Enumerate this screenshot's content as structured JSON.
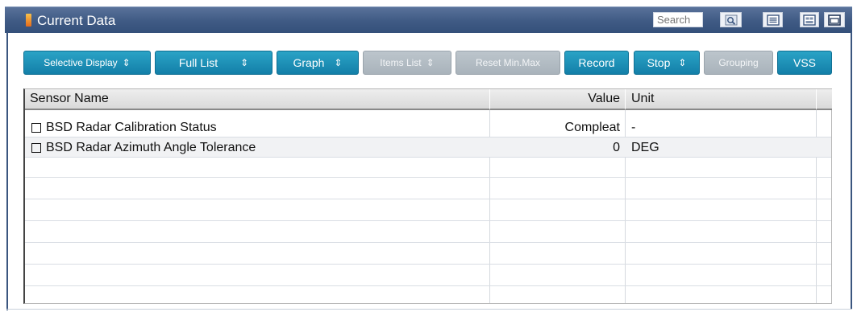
{
  "window": {
    "title": "Current Data",
    "search_placeholder": "Search"
  },
  "toolbar": {
    "buttons": [
      {
        "label": "Selective Display",
        "has_arrows": true,
        "enabled": true
      },
      {
        "label": "Full List",
        "has_arrows": true,
        "enabled": true
      },
      {
        "label": "Graph",
        "has_arrows": true,
        "enabled": true
      },
      {
        "label": "Items List",
        "has_arrows": true,
        "enabled": false
      },
      {
        "label": "Reset Min.Max",
        "has_arrows": false,
        "enabled": false
      },
      {
        "label": "Record",
        "has_arrows": false,
        "enabled": true
      },
      {
        "label": "Stop",
        "has_arrows": true,
        "enabled": true
      },
      {
        "label": "Grouping",
        "has_arrows": false,
        "enabled": false
      },
      {
        "label": "VSS",
        "has_arrows": false,
        "enabled": true
      }
    ],
    "arrow_glyph": "⇕"
  },
  "table": {
    "headers": {
      "sensor": "Sensor Name",
      "value": "Value",
      "unit": "Unit"
    },
    "rows": [
      {
        "sensor": "BSD Radar Calibration Status",
        "value": "Compleat",
        "unit": "-",
        "checked": false
      },
      {
        "sensor": "BSD Radar Azimuth Angle Tolerance",
        "value": "0",
        "unit": "DEG",
        "checked": false
      }
    ]
  },
  "colors": {
    "titlebar": "#3f5a84",
    "button_active": "#1a8db5",
    "button_disabled": "#b0b9c1"
  },
  "icons": [
    "search-icon",
    "list-icon",
    "grid-icon",
    "window-icon",
    "title-bar-icon"
  ]
}
